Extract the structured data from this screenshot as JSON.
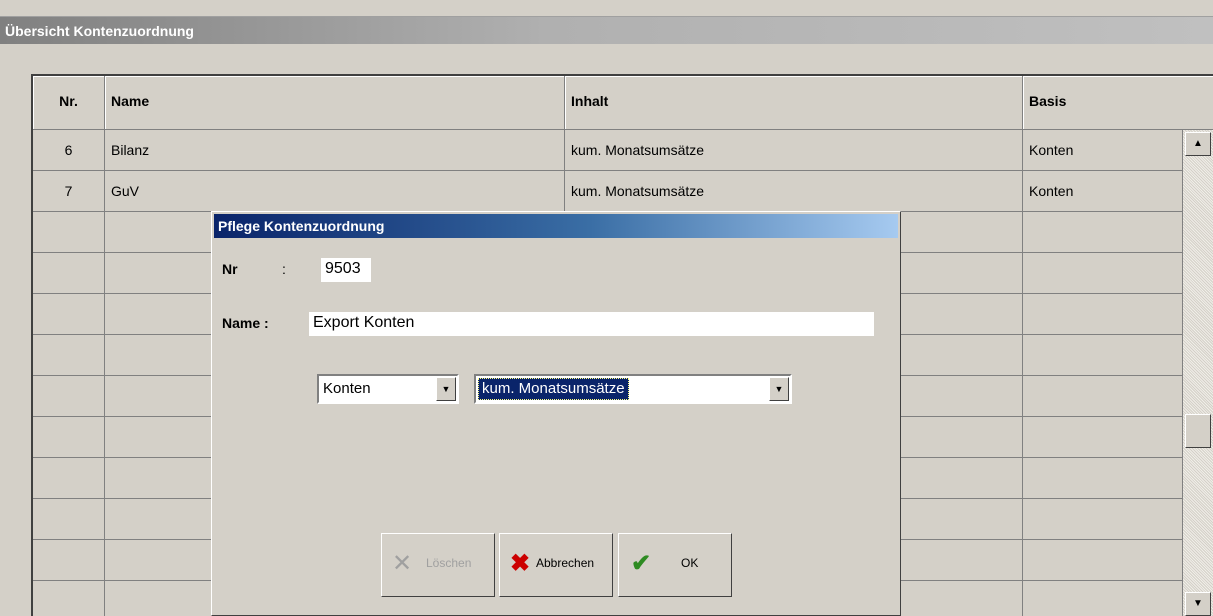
{
  "window": {
    "title": "Übersicht Kontenzuordnung"
  },
  "table": {
    "headers": [
      "Nr.",
      "Name",
      "Inhalt",
      "Basis"
    ],
    "rows": [
      {
        "nr": "6",
        "name": "Bilanz",
        "inhalt": "kum. Monatsumsätze",
        "basis": "Konten"
      },
      {
        "nr": "7",
        "name": "GuV",
        "inhalt": "kum. Monatsumsätze",
        "basis": "Konten"
      }
    ]
  },
  "dialog": {
    "title": "Pflege Kontenzuordnung",
    "nr_label": "Nr",
    "nr_sep": ":",
    "nr_value": "9503",
    "name_label": "Name :",
    "name_value": "Export Konten",
    "basis_selected": "Konten",
    "inhalt_selected": "kum. Monatsumsätze",
    "buttons": {
      "delete": "Löschen",
      "cancel": "Abbrechen",
      "ok": "OK"
    }
  },
  "icons": {
    "scroll_up": "arrow-up-icon",
    "scroll_down": "arrow-down-icon",
    "combo": "chevron-down-icon",
    "delete": "x-icon",
    "cancel": "red-x-icon",
    "ok": "green-check-icon"
  },
  "colors": {
    "dialog_title_start": "#0a246a",
    "dialog_title_end": "#a6caf0",
    "cancel_icon": "#cc0000",
    "ok_icon": "#2e8b22"
  }
}
